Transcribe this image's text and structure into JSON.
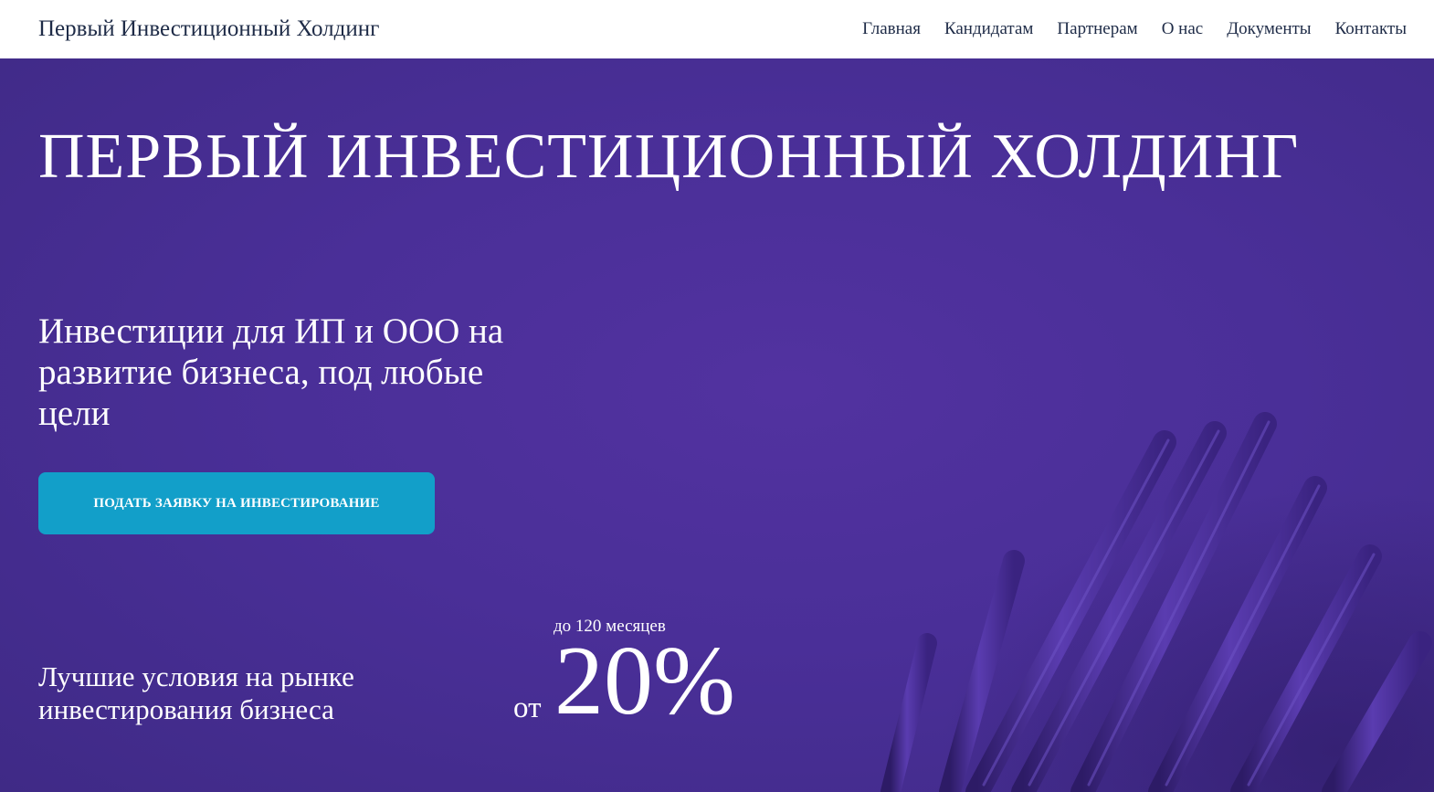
{
  "header": {
    "brand": "Первый Инвестиционный Холдинг",
    "nav": [
      "Главная",
      "Кандидатам",
      "Партнерам",
      "О нас",
      "Документы",
      "Контакты"
    ]
  },
  "hero": {
    "title": "ПЕРВЫЙ ИНВЕСТИЦИОННЫЙ ХОЛДИНГ",
    "subtitle": "Инвестиции для ИП и ООО на развитие бизнеса, под любые цели",
    "cta_label": "ПОДАТЬ ЗАЯВКУ НА ИНВЕСТИРОВАНИЕ",
    "best_conditions": "Лучшие условия на рынке инвестирования бизнеса",
    "term": "до 120 месяцев",
    "rate_prefix": "от",
    "rate_value": "20%"
  },
  "colors": {
    "hero_background": "#4a2f98",
    "cta_background": "#129fc9",
    "header_text": "#1e2b47"
  }
}
